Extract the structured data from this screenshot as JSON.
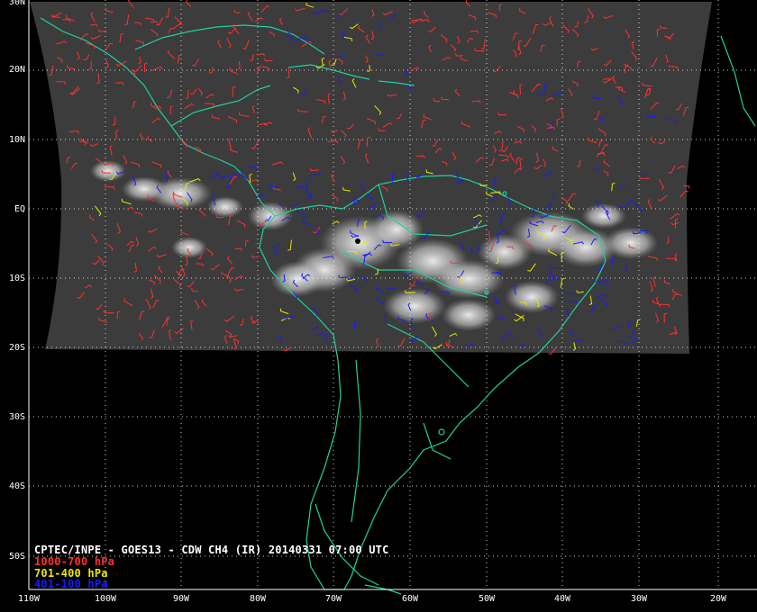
{
  "title": "CPTEC/INPE - GOES13 - CDW CH4 (IR) 20140331 07:00 UTC",
  "lat_labels": [
    "30N",
    "20N",
    "10N",
    "EQ",
    "10S",
    "20S",
    "30S",
    "40S",
    "50S"
  ],
  "lon_labels": [
    "110W",
    "100W",
    "90W",
    "80W",
    "70W",
    "60W",
    "50W",
    "40W",
    "30W",
    "20W"
  ],
  "legend": [
    {
      "label": "1000-700 hPa",
      "color": "#ff3030"
    },
    {
      "label": "701-400 hPa",
      "color": "#e8e800"
    },
    {
      "label": "401-100 hPa",
      "color": "#1a1aff"
    }
  ],
  "colors": {
    "coastline": "#20d0a0",
    "grid": "#ffffff",
    "frame": "#ffffff",
    "background": "#000000"
  }
}
